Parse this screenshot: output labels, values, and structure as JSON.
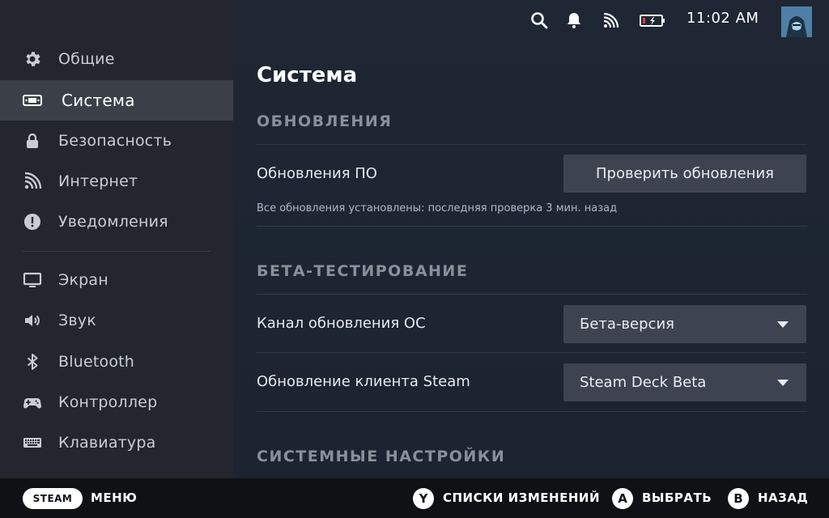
{
  "sidebar": {
    "items": [
      {
        "label": "Общие",
        "icon": "gear-icon"
      },
      {
        "label": "Система",
        "icon": "steam-deck-icon",
        "active": true
      },
      {
        "label": "Безопасность",
        "icon": "lock-icon"
      },
      {
        "label": "Интернет",
        "icon": "wifi-icon"
      },
      {
        "label": "Уведомления",
        "icon": "alert-icon"
      },
      {
        "label": "Экран",
        "icon": "monitor-icon"
      },
      {
        "label": "Звук",
        "icon": "speaker-icon"
      },
      {
        "label": "Bluetooth",
        "icon": "bluetooth-icon"
      },
      {
        "label": "Контроллер",
        "icon": "gamepad-icon"
      },
      {
        "label": "Клавиатура",
        "icon": "keyboard-icon"
      }
    ]
  },
  "status_bar": {
    "time": "11:02 AM",
    "icons": [
      "search-icon",
      "bell-icon",
      "wifi-icon",
      "battery-charging-icon"
    ]
  },
  "page": {
    "title": "Система",
    "sections": {
      "updates": {
        "header": "ОБНОВЛЕНИЯ",
        "software_updates_label": "Обновления ПО",
        "check_button": "Проверить обновления",
        "status_note": "Все обновления установлены: последняя проверка 3 мин. назад"
      },
      "beta": {
        "header": "БЕТА-ТЕСТИРОВАНИЕ",
        "os_channel_label": "Канал обновления ОС",
        "os_channel_value": "Бета-версия",
        "client_label": "Обновление клиента Steam",
        "client_value": "Steam Deck Beta"
      },
      "system_settings": {
        "header": "СИСТЕМНЫЕ НАСТРОЙКИ"
      }
    }
  },
  "footer": {
    "steam_button": "STEAM",
    "menu_label": "МЕНЮ",
    "y_button": "Y",
    "y_label": "СПИСКИ ИЗМЕНЕНИЙ",
    "a_button": "A",
    "a_label": "ВЫБРАТЬ",
    "b_button": "B",
    "b_label": "НАЗАД"
  },
  "colors": {
    "sidebar_bg": "#23262e",
    "sidebar_active": "#3b3f47",
    "main_bg": "#1b2430",
    "control_bg": "#3d4450",
    "footer_bg": "#0f1114"
  }
}
